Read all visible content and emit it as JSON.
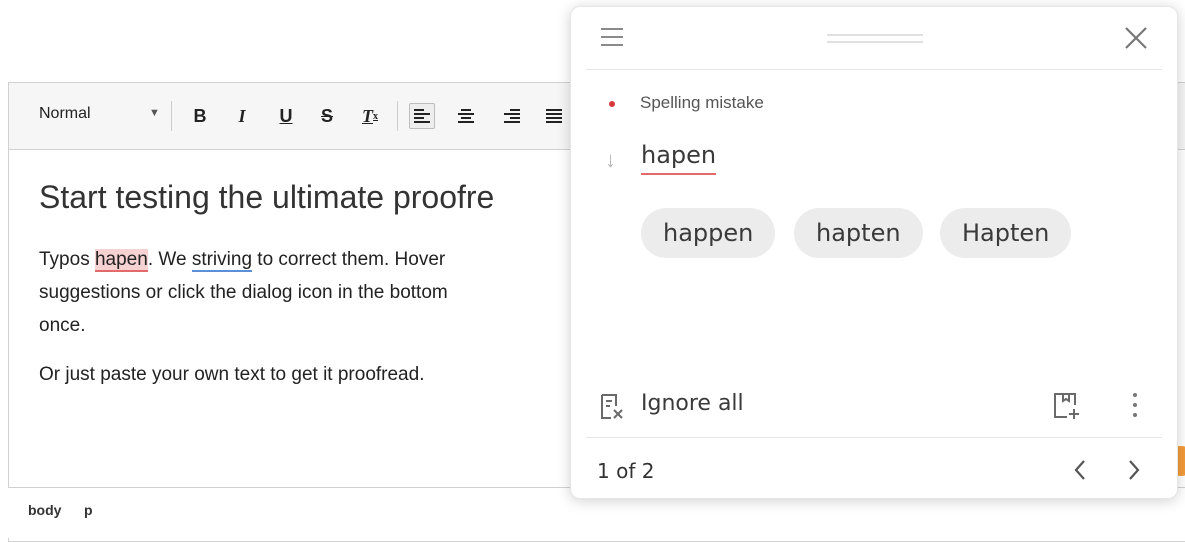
{
  "editor": {
    "toolbar": {
      "format_label": "Normal",
      "buttons": {
        "bold": "B",
        "italic": "I",
        "underline": "U",
        "strike": "S",
        "clear_format": "T"
      }
    },
    "content": {
      "heading": "Start testing the ultimate proofre",
      "p1_before": "Typos ",
      "p1_err1": "hapen",
      "p1_mid": ". We ",
      "p1_err2": "striving",
      "p1_after": " to correct them. Hover",
      "p1_line2": "suggestions or click the dialog icon in the bottom",
      "p1_line3": "once.",
      "p2": "Or just paste your own text to get it proofread."
    },
    "statusbar": {
      "path_body": "body",
      "path_p": "p"
    }
  },
  "panel": {
    "error_type": "Spelling mistake",
    "error_word": "hapen",
    "suggestions": [
      "happen",
      "hapten",
      "Hapten"
    ],
    "ignore_label": "Ignore all",
    "pager": "1 of 2"
  },
  "colors": {
    "spelling_error": "#e26a6a",
    "grammar_error": "#5b8fd6",
    "status_dot": "#d83a3a",
    "accent_orange": "#f39b3a"
  }
}
